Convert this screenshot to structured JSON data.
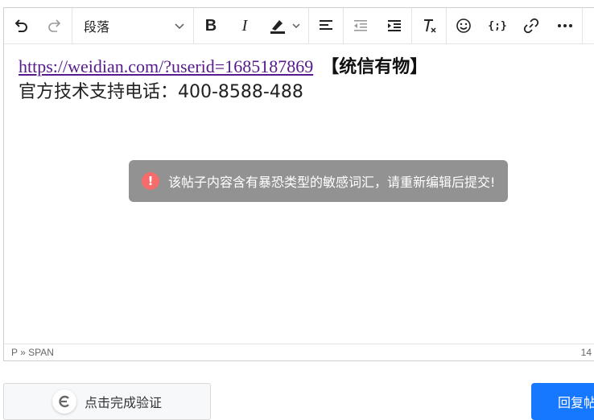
{
  "toolbar": {
    "format_value": "段落"
  },
  "content": {
    "link_text": "https://weidian.com/?userid=1685187869",
    "brand_text": "【统信有物】",
    "phone_text": "官方技术支持电话：400-8588-488"
  },
  "statusbar": {
    "path": "P » SPAN",
    "word_count": "14"
  },
  "toast": {
    "message": "该帖子内容含有暴恐类型的敏感词汇，请重新编辑后提交!"
  },
  "verify": {
    "label": "点击完成验证"
  },
  "reply": {
    "label": "回复帖"
  },
  "colors": {
    "accent": "#1677ff",
    "error": "#f56c6c",
    "link": "#551a8b"
  }
}
